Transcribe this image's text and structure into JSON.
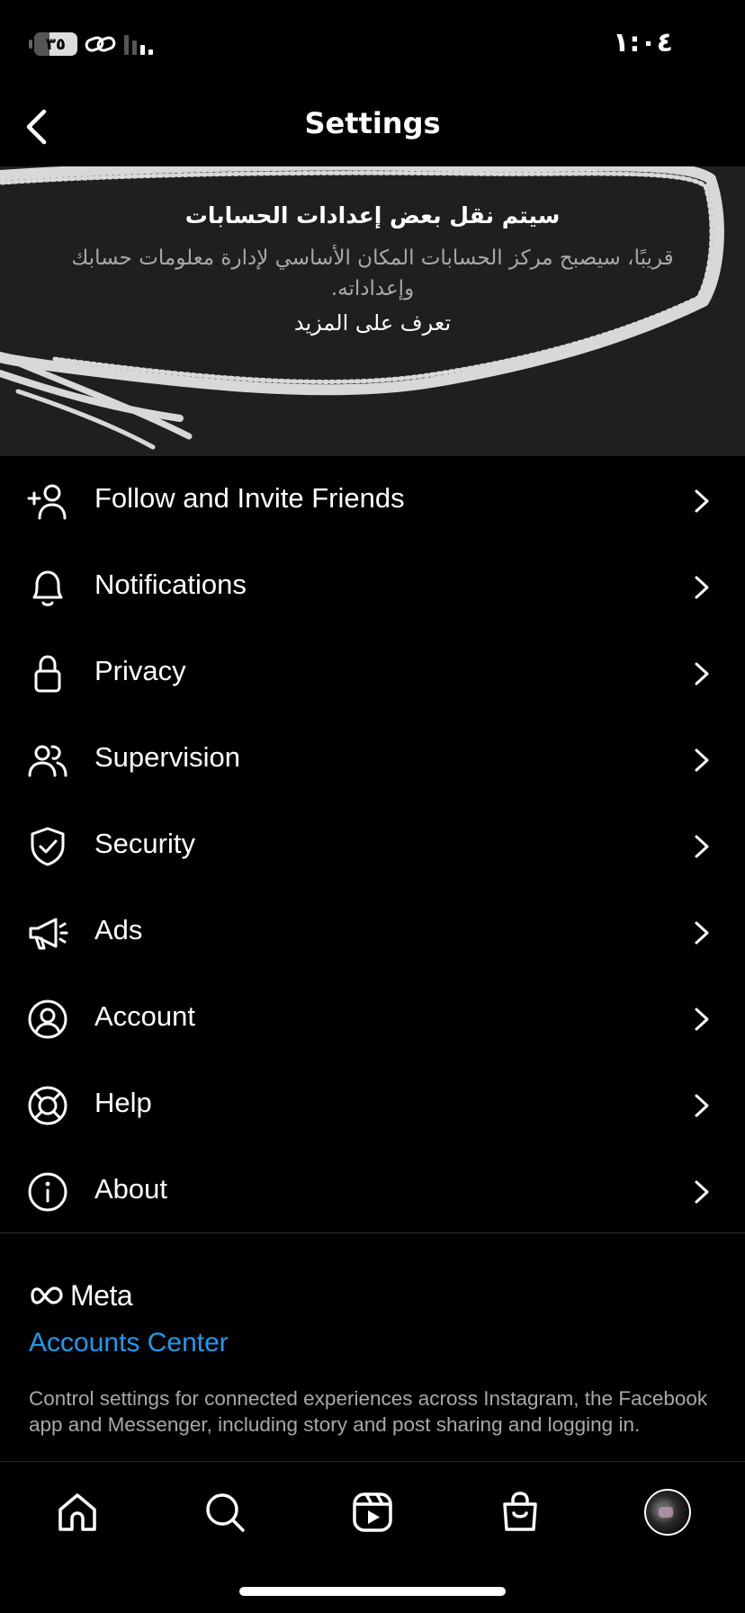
{
  "status_bar": {
    "time": "١:٠٤",
    "battery": "٣٥",
    "battery_level": 0.35
  },
  "header": {
    "title": "Settings"
  },
  "banner": {
    "title": "سيتم نقل بعض إعدادات الحسابات",
    "body": "قريبًا، سيصبح مركز الحسابات المكان الأساسي لإدارة معلومات حسابك وإعداداته.",
    "link": "تعرف على المزيد"
  },
  "menu": {
    "items": [
      {
        "label": "Follow and Invite Friends",
        "icon": "add-person-icon"
      },
      {
        "label": "Notifications",
        "icon": "bell-icon"
      },
      {
        "label": "Privacy",
        "icon": "lock-icon"
      },
      {
        "label": "Supervision",
        "icon": "people-icon"
      },
      {
        "label": "Security",
        "icon": "shield-icon"
      },
      {
        "label": "Ads",
        "icon": "megaphone-icon"
      },
      {
        "label": "Account",
        "icon": "user-circle-icon"
      },
      {
        "label": "Help",
        "icon": "lifebuoy-icon"
      },
      {
        "label": "About",
        "icon": "info-icon"
      }
    ]
  },
  "meta": {
    "logo_text": "Meta",
    "accounts_center": "Accounts Center",
    "description": "Control settings for connected experiences across Instagram, the Facebook app and Messenger, including story and post sharing and logging in."
  },
  "tabbar": {
    "tabs": [
      {
        "name": "home",
        "icon": "home-icon"
      },
      {
        "name": "search",
        "icon": "search-icon"
      },
      {
        "name": "reels",
        "icon": "reels-icon"
      },
      {
        "name": "shop",
        "icon": "shopping-bag-icon"
      },
      {
        "name": "profile",
        "icon": "avatar"
      }
    ]
  },
  "colors": {
    "background": "#000000",
    "banner": "#1f1f1f",
    "link": "#1d9bf0",
    "muted": "#a8a8a8"
  }
}
